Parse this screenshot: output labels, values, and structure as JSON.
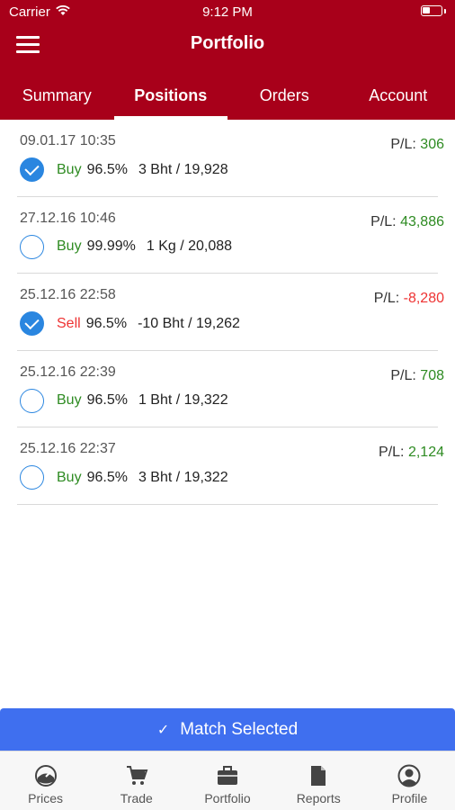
{
  "status_bar": {
    "carrier": "Carrier",
    "time": "9:12 PM"
  },
  "header": {
    "title": "Portfolio"
  },
  "tabs": [
    {
      "label": "Summary",
      "active": false
    },
    {
      "label": "Positions",
      "active": true
    },
    {
      "label": "Orders",
      "active": false
    },
    {
      "label": "Account",
      "active": false
    }
  ],
  "positions": [
    {
      "date": "09.01.17 10:35",
      "pl_label": "P/L:",
      "pl_value": "306",
      "pl_sign": "pos",
      "side": "Buy",
      "purity": "96.5%",
      "detail": "3 Bht / 19,928",
      "selected": true
    },
    {
      "date": "27.12.16 10:46",
      "pl_label": "P/L:",
      "pl_value": "43,886",
      "pl_sign": "pos",
      "side": "Buy",
      "purity": "99.99%",
      "detail": "1 Kg / 20,088",
      "selected": false
    },
    {
      "date": "25.12.16 22:58",
      "pl_label": "P/L:",
      "pl_value": "-8,280",
      "pl_sign": "neg",
      "side": "Sell",
      "purity": "96.5%",
      "detail": "-10 Bht / 19,262",
      "selected": true
    },
    {
      "date": "25.12.16 22:39",
      "pl_label": "P/L:",
      "pl_value": "708",
      "pl_sign": "pos",
      "side": "Buy",
      "purity": "96.5%",
      "detail": "1 Bht / 19,322",
      "selected": false
    },
    {
      "date": "25.12.16 22:37",
      "pl_label": "P/L:",
      "pl_value": "2,124",
      "pl_sign": "pos",
      "side": "Buy",
      "purity": "96.5%",
      "detail": "3 Bht / 19,322",
      "selected": false
    }
  ],
  "match_button": {
    "icon": "checkmark-icon",
    "label": "Match Selected"
  },
  "tabbar": [
    {
      "label": "Prices",
      "icon": "prices-gauge-icon"
    },
    {
      "label": "Trade",
      "icon": "cart-icon"
    },
    {
      "label": "Portfolio",
      "icon": "briefcase-icon"
    },
    {
      "label": "Reports",
      "icon": "document-icon"
    },
    {
      "label": "Profile",
      "icon": "person-icon"
    }
  ],
  "colors": {
    "brand_red": "#a8001a",
    "buy_green": "#2e8b22",
    "sell_red": "#ee3333",
    "accent_blue": "#3f6fef",
    "check_blue": "#2a86e0"
  }
}
